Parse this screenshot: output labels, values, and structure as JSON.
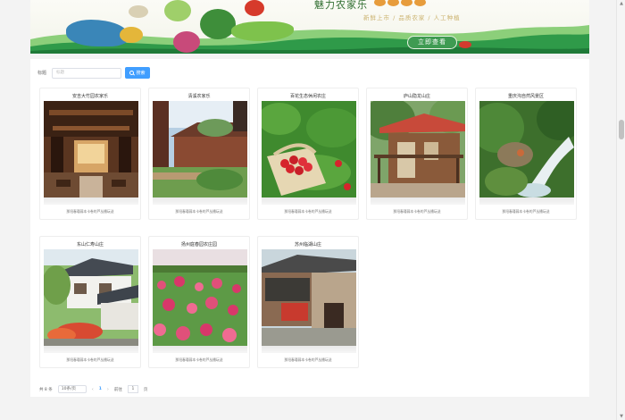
{
  "banner": {
    "title": "魅力农家乐",
    "subtitle": "新鲜上市 / 品质农家 / 人工种植",
    "cta_label": "立即查看"
  },
  "search": {
    "label": "标题",
    "placeholder": "标题",
    "button_label": "搜索"
  },
  "cards": [
    {
      "name": "安吉大竹园农家乐",
      "desc": "那阳春瑾暮本卡卷的芦丛播玩送"
    },
    {
      "name": "清溪农家乐",
      "desc": "那阳春瑾暮本卡卷的芦丛播玩送"
    },
    {
      "name": "百花生态休闲农庄",
      "desc": "那阳春瑾暮本卡卷的芦丛播玩送"
    },
    {
      "name": "庐山隐龙山庄",
      "desc": "那阳春瑾暮本卡卷的芦丛播玩送"
    },
    {
      "name": "重庆沟自然风景区",
      "desc": "那阳春瑾暮本卡卷的芦丛播玩送"
    },
    {
      "name": "东山仁寿山庄",
      "desc": "那阳春瑾暮本卡卷的芦丛播玩送"
    },
    {
      "name": "扬州庭春园农庄园",
      "desc": "那阳春瑾暮本卡卷的芦丛播玩送"
    },
    {
      "name": "苏州临湖山庄",
      "desc": "那阳春瑾暮本卡卷的芦丛播玩送"
    }
  ],
  "pager": {
    "total": "共 8 条",
    "page_size": "10条/页",
    "current_page": "1",
    "goto_label": "前往",
    "goto_value": "1",
    "page_suffix": "页"
  }
}
